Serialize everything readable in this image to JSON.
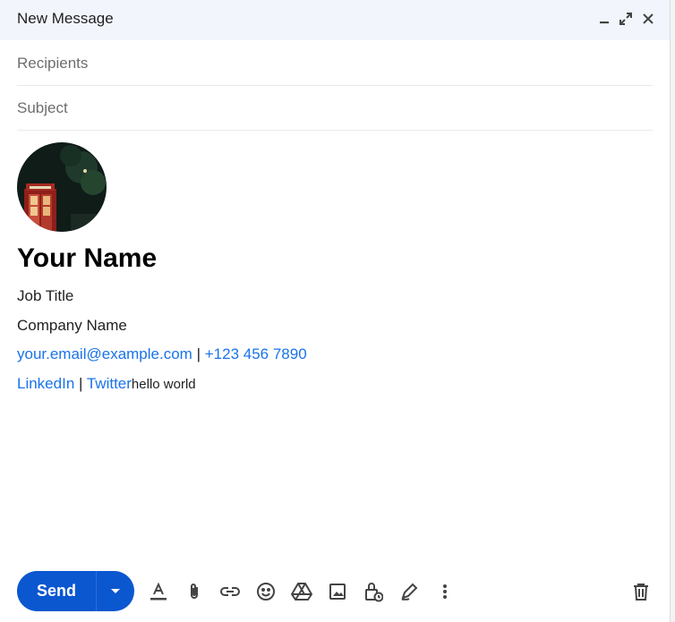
{
  "window": {
    "title": "New Message"
  },
  "header_icons": {
    "minimize": "minimize-icon",
    "expand": "expand-icon",
    "close": "close-icon"
  },
  "fields": {
    "recipients_placeholder": "Recipients",
    "subject_placeholder": "Subject"
  },
  "signature": {
    "name": "Your Name",
    "job_title": "Job Title",
    "company": "Company Name",
    "email": "your.email@example.com",
    "separator": "|",
    "phone": "+123 456 7890",
    "linkedin": "LinkedIn",
    "twitter": "Twitter",
    "body_text": "hello world"
  },
  "toolbar": {
    "send_label": "Send",
    "tools": [
      "formatting-icon",
      "attach-icon",
      "link-icon",
      "emoji-icon",
      "drive-icon",
      "photo-icon",
      "confidential-icon",
      "signature-icon",
      "more-options-icon"
    ],
    "discard": "trash-icon"
  },
  "colors": {
    "header_bg": "#f2f6fc",
    "accent": "#0b57d0",
    "link": "#1a73e8"
  }
}
